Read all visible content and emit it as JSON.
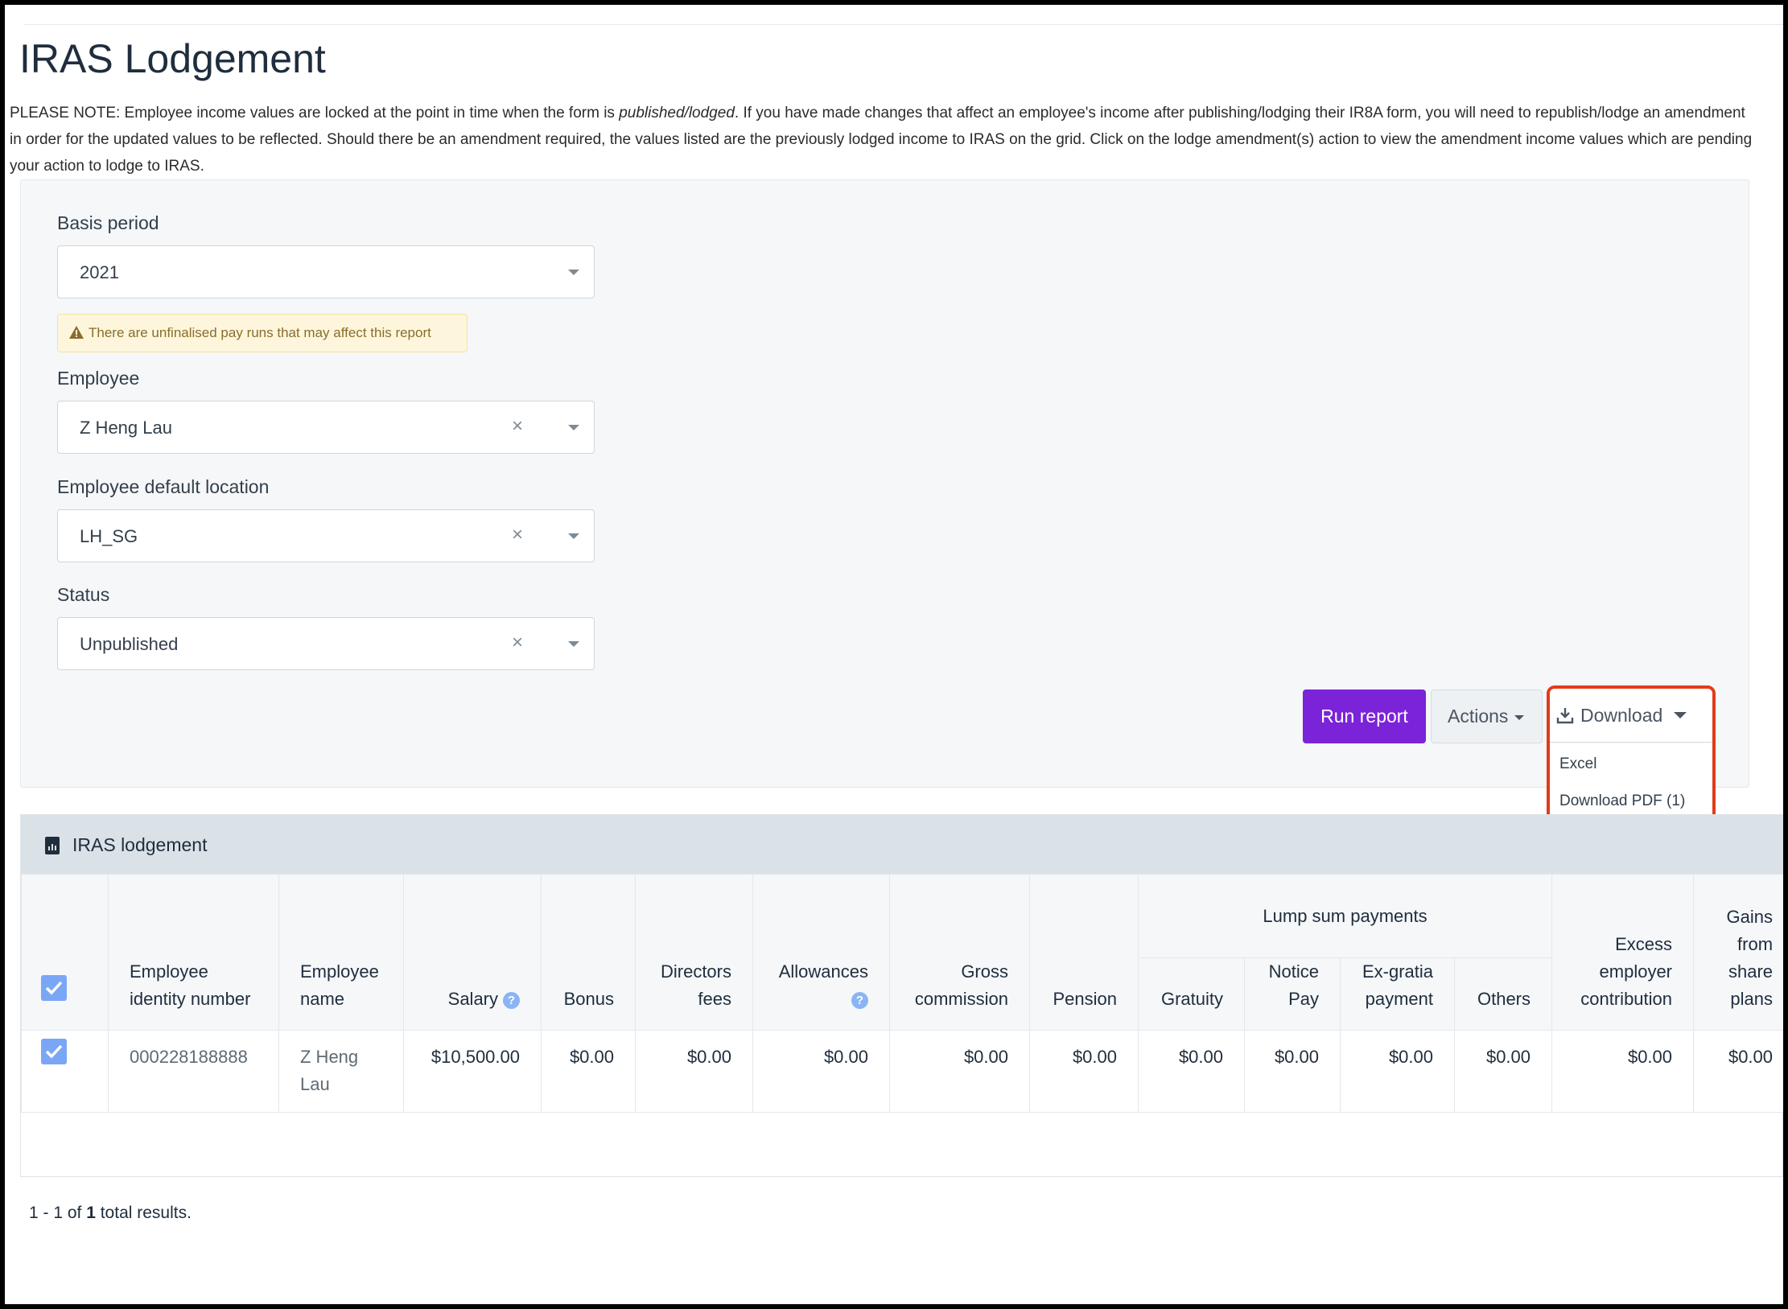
{
  "page": {
    "title": "IRAS Lodgement",
    "notice_prefix": "PLEASE NOTE: Employee income values are locked at the point in time when the form is ",
    "notice_italic": "published/lodged",
    "notice_suffix": ". If you have made changes that affect an employee's income after publishing/lodging their IR8A form, you will need to republish/lodge an amendment in order for the updated values to be reflected. Should there be an amendment required, the values listed are the previously lodged income to IRAS on the grid. Click on the lodge amendment(s) action to view the amendment income values which are pending your action to lodge to IRAS."
  },
  "filters": {
    "basis_period": {
      "label": "Basis period",
      "value": "2021"
    },
    "warning": "There are unfinalised pay runs that may affect this report",
    "employee": {
      "label": "Employee",
      "value": "Z Heng Lau",
      "clear": "×"
    },
    "location": {
      "label": "Employee default location",
      "value": "LH_SG",
      "clear": "×"
    },
    "status": {
      "label": "Status",
      "value": "Unpublished",
      "clear": "×"
    }
  },
  "toolbar": {
    "run_report": "Run report",
    "actions": "Actions",
    "download": "Download",
    "download_menu": [
      "Excel",
      "Download PDF (1)"
    ]
  },
  "report": {
    "title": "IRAS lodgement",
    "group_header": "Lump sum payments",
    "columns": {
      "id": "Employee identity number",
      "name": "Employee name",
      "salary": "Salary",
      "bonus": "Bonus",
      "directors": "Directors fees",
      "allowances": "Allowances",
      "gross": "Gross commission",
      "pension": "Pension",
      "gratuity": "Gratuity",
      "notice": "Notice Pay",
      "exgratia": "Ex-gratia payment",
      "others": "Others",
      "excess": "Excess employer contribution",
      "gains": "Gains from share plans"
    },
    "help_glyph": "?",
    "row": {
      "id": "000228188888",
      "name": "Z Heng Lau",
      "salary": "$10,500.00",
      "bonus": "$0.00",
      "directors": "$0.00",
      "allowances": "$0.00",
      "gross": "$0.00",
      "pension": "$0.00",
      "gratuity": "$0.00",
      "notice": "$0.00",
      "exgratia": "$0.00",
      "others": "$0.00",
      "excess": "$0.00",
      "gains": "$0.00"
    },
    "results_prefix": "1 - 1 of ",
    "results_count": "1",
    "results_suffix": " total results."
  },
  "colors": {
    "primary": "#7b23d9",
    "highlight": "#e23b1a",
    "checkbox": "#7aa7f5"
  }
}
